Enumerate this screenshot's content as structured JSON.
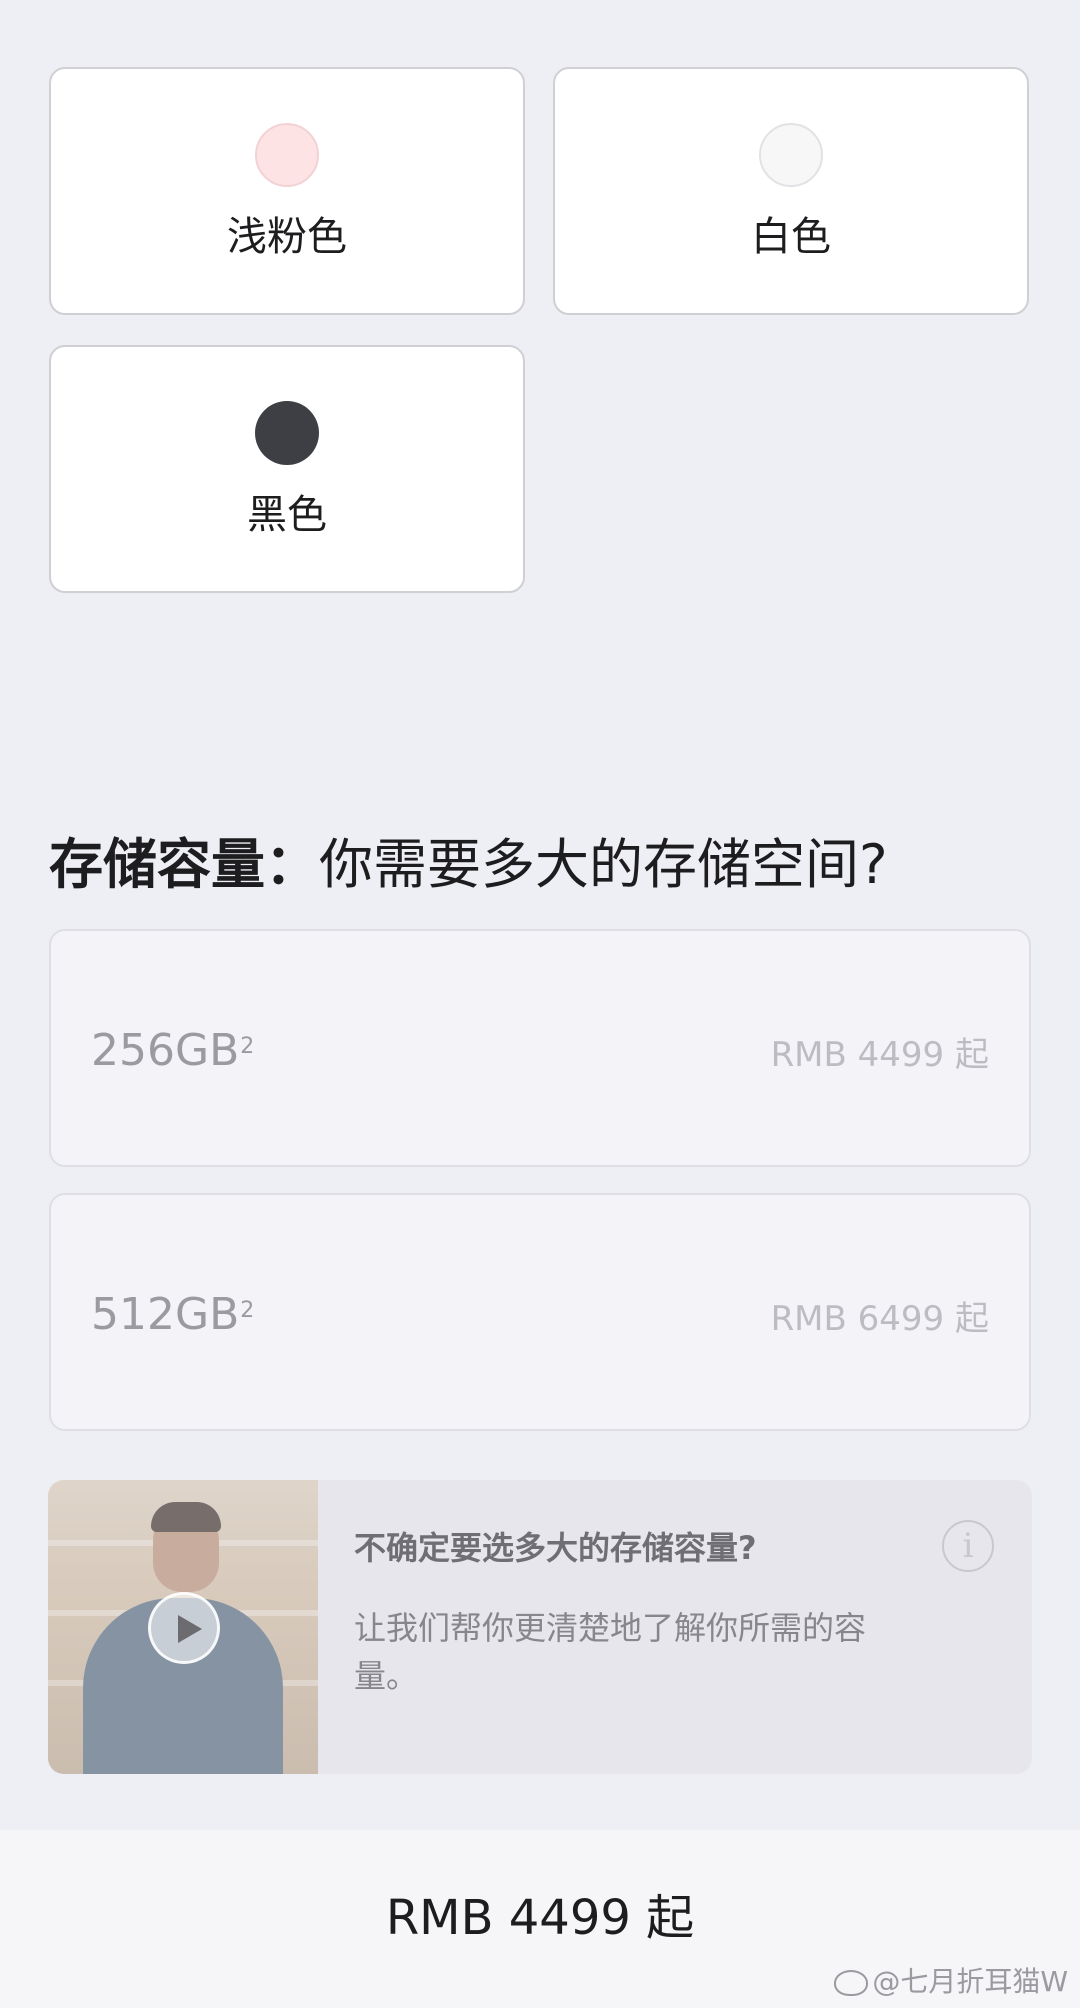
{
  "colors": {
    "options": [
      {
        "label": "浅粉色",
        "swatch": "#fde3e4"
      },
      {
        "label": "白色",
        "swatch": "#f7f7f7"
      },
      {
        "label": "黑色",
        "swatch": "#3d3f44"
      }
    ]
  },
  "storage": {
    "title_bold": "存储容量：",
    "title_rest": "你需要多大的存储空间?",
    "options": [
      {
        "capacity": "256GB",
        "footnote": "2",
        "price": "RMB 4499 起"
      },
      {
        "capacity": "512GB",
        "footnote": "2",
        "price": "RMB 6499 起"
      }
    ]
  },
  "help": {
    "title": "不确定要选多大的存储容量?",
    "description": "让我们帮你更清楚地了解你所需的容量。",
    "video_icon": "play-icon",
    "info_icon": "info-icon",
    "info_glyph": "i"
  },
  "footer": {
    "price": "RMB 4499 起"
  },
  "watermark": {
    "text": "@七月折耳猫W",
    "icon": "weibo-icon"
  }
}
